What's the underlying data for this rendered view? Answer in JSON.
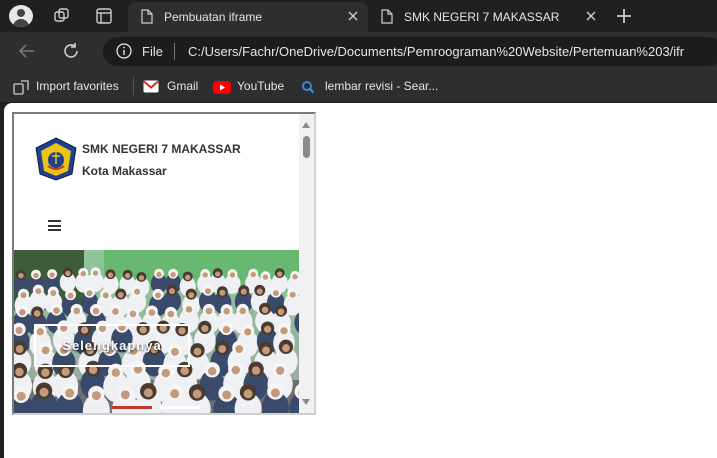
{
  "browser": {
    "tabs": [
      {
        "title": "Pembuatan iframe",
        "active": true
      },
      {
        "title": "SMK NEGERI 7 MAKASSAR",
        "active": false
      }
    ],
    "address": {
      "scheme": "File",
      "url": "C:/Users/Fachr/OneDrive/Documents/Pemroograman%20Website/Pertemuan%203/ifr"
    },
    "bookmarks": [
      {
        "label": "Import favorites",
        "icon": "import-favorites-icon"
      },
      {
        "label": "Gmail",
        "icon": "gmail-icon"
      },
      {
        "label": "YouTube",
        "icon": "youtube-icon"
      },
      {
        "label": "lembar revisi - Sear...",
        "icon": "search-icon"
      }
    ],
    "colors": {
      "chrome": "#202020",
      "toolbar": "#2e2e2e",
      "omnibox": "#1c1c1c",
      "youtube": "#ff0000"
    }
  },
  "iframe": {
    "school_name": "SMK NEGERI 7 MAKASSAR",
    "city": "Kota Makassar",
    "hero_button": "Selengkapnya",
    "slides": 2,
    "active_slide": 1,
    "colors": {
      "active_indicator": "#c0392b",
      "inactive_indicator": "#ffffff"
    }
  }
}
